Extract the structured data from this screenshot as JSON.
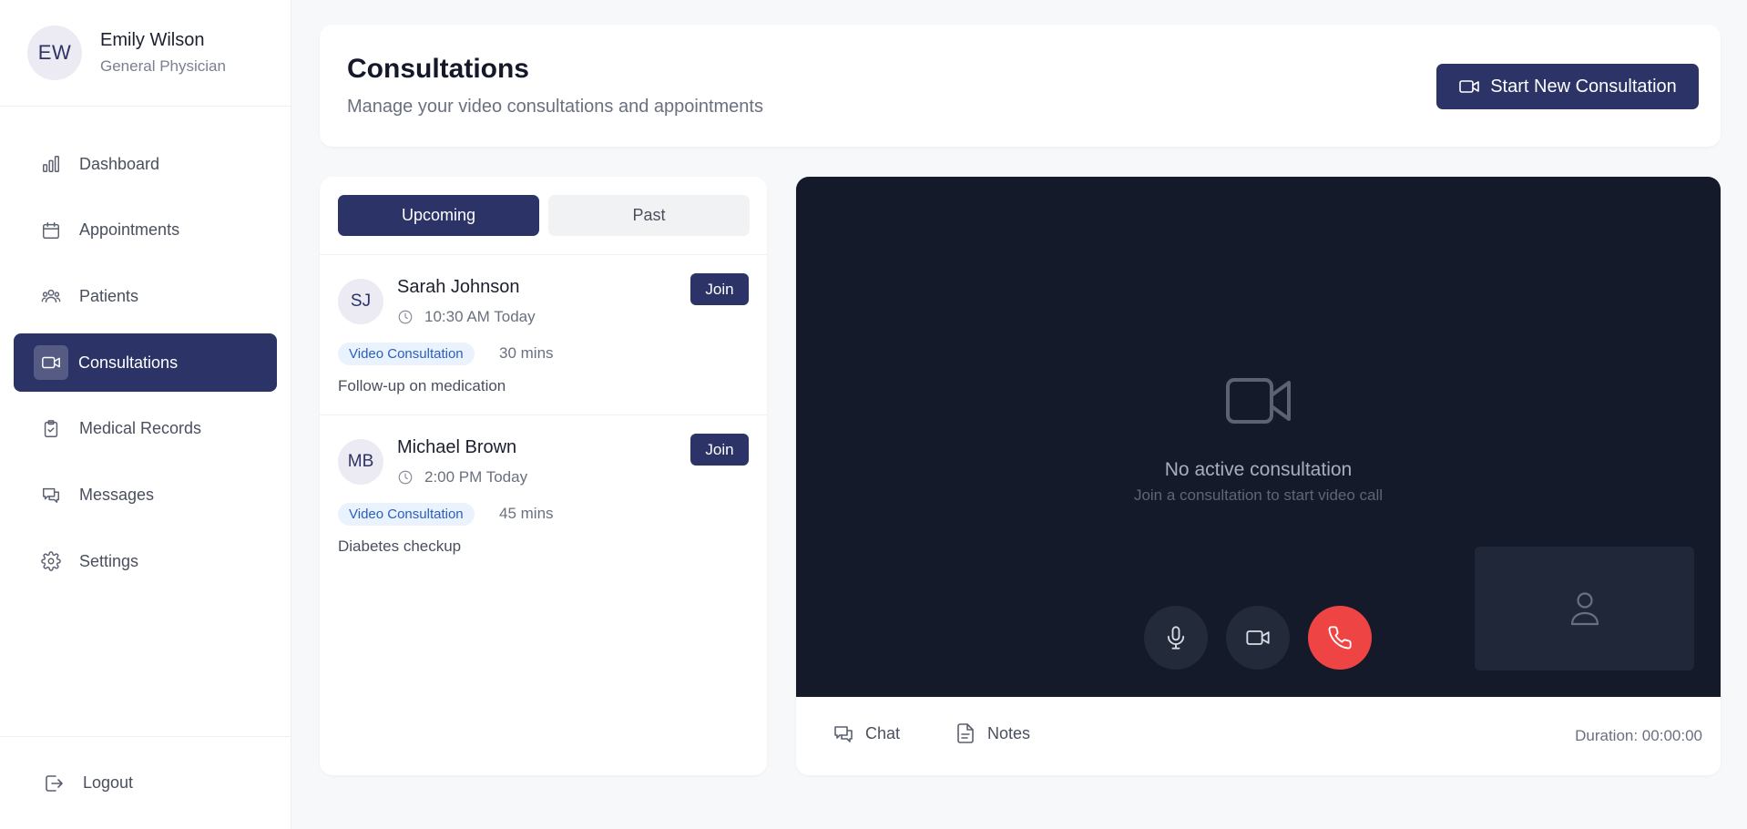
{
  "user": {
    "initials": "EW",
    "name": "Emily Wilson",
    "role": "General Physician"
  },
  "nav": {
    "items": [
      {
        "label": "Dashboard",
        "icon": "bar-chart-icon",
        "active": false
      },
      {
        "label": "Appointments",
        "icon": "calendar-icon",
        "active": false
      },
      {
        "label": "Patients",
        "icon": "users-icon",
        "active": false
      },
      {
        "label": "Consultations",
        "icon": "video-icon",
        "active": true
      },
      {
        "label": "Medical Records",
        "icon": "clipboard-icon",
        "active": false
      },
      {
        "label": "Messages",
        "icon": "chat-icon",
        "active": false
      },
      {
        "label": "Settings",
        "icon": "gear-icon",
        "active": false
      }
    ],
    "logout": "Logout"
  },
  "header": {
    "title": "Consultations",
    "subtitle": "Manage your video consultations and appointments",
    "start_button": "Start New Consultation"
  },
  "tabs": {
    "upcoming": "Upcoming",
    "past": "Past",
    "active": "upcoming"
  },
  "consultations": [
    {
      "initials": "SJ",
      "name": "Sarah Johnson",
      "time": "10:30 AM Today",
      "type": "Video Consultation",
      "duration": "30 mins",
      "note": "Follow-up on medication",
      "join_label": "Join"
    },
    {
      "initials": "MB",
      "name": "Michael Brown",
      "time": "2:00 PM Today",
      "type": "Video Consultation",
      "duration": "45 mins",
      "note": "Diabetes checkup",
      "join_label": "Join"
    }
  ],
  "video": {
    "empty_title": "No active consultation",
    "empty_hint": "Join a consultation to start video call",
    "chat_label": "Chat",
    "notes_label": "Notes",
    "call_duration": "Duration: 00:00:00"
  },
  "colors": {
    "brand": "#2c3366",
    "end_call": "#ef4444",
    "video_bg": "#141a2a",
    "tag_bg": "#eaf2fd",
    "tag_text": "#2a5fbf"
  }
}
